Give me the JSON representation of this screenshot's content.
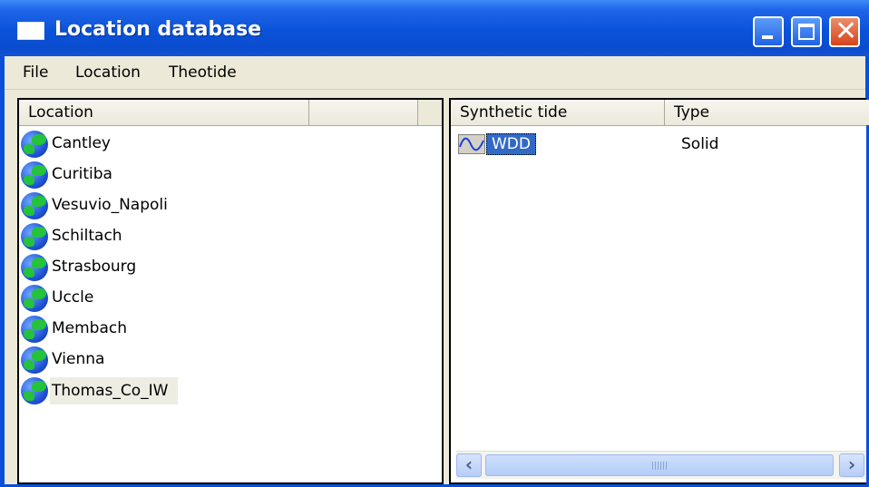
{
  "window": {
    "title": "Location database",
    "controls": [
      "minimize-icon",
      "maximize-icon",
      "close-icon"
    ]
  },
  "menu": {
    "items": [
      "File",
      "Location",
      "Theotide"
    ]
  },
  "locations": {
    "columns": [
      "Location",
      ""
    ],
    "items": [
      {
        "name": "Cantley",
        "icon": "globe-icon"
      },
      {
        "name": "Curitiba",
        "icon": "globe-icon"
      },
      {
        "name": "Vesuvio_Napoli",
        "icon": "globe-icon"
      },
      {
        "name": "Schiltach",
        "icon": "globe-icon"
      },
      {
        "name": "Strasbourg",
        "icon": "globe-icon"
      },
      {
        "name": "Uccle",
        "icon": "globe-icon"
      },
      {
        "name": "Membach",
        "icon": "globe-icon"
      },
      {
        "name": "Vienna",
        "icon": "globe-icon"
      },
      {
        "name": "Thomas_Co_IW",
        "icon": "globe-icon",
        "selected": true
      }
    ]
  },
  "tides": {
    "columns": [
      "Synthetic tide",
      "Type"
    ],
    "rows": [
      {
        "name": "WDD",
        "type": "Solid",
        "icon": "wave-icon",
        "selected": true
      }
    ]
  },
  "colors": {
    "titlebar": "#0a53d8",
    "selection": "#316ac5",
    "close_button": "#d6431b"
  }
}
